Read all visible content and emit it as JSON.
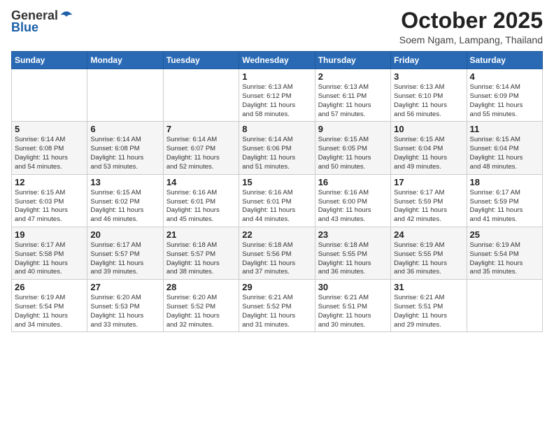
{
  "header": {
    "logo_general": "General",
    "logo_blue": "Blue",
    "title": "October 2025",
    "subtitle": "Soem Ngam, Lampang, Thailand"
  },
  "weekdays": [
    "Sunday",
    "Monday",
    "Tuesday",
    "Wednesday",
    "Thursday",
    "Friday",
    "Saturday"
  ],
  "weeks": [
    [
      {
        "day": "",
        "info": ""
      },
      {
        "day": "",
        "info": ""
      },
      {
        "day": "",
        "info": ""
      },
      {
        "day": "1",
        "info": "Sunrise: 6:13 AM\nSunset: 6:12 PM\nDaylight: 11 hours\nand 58 minutes."
      },
      {
        "day": "2",
        "info": "Sunrise: 6:13 AM\nSunset: 6:11 PM\nDaylight: 11 hours\nand 57 minutes."
      },
      {
        "day": "3",
        "info": "Sunrise: 6:13 AM\nSunset: 6:10 PM\nDaylight: 11 hours\nand 56 minutes."
      },
      {
        "day": "4",
        "info": "Sunrise: 6:14 AM\nSunset: 6:09 PM\nDaylight: 11 hours\nand 55 minutes."
      }
    ],
    [
      {
        "day": "5",
        "info": "Sunrise: 6:14 AM\nSunset: 6:08 PM\nDaylight: 11 hours\nand 54 minutes."
      },
      {
        "day": "6",
        "info": "Sunrise: 6:14 AM\nSunset: 6:08 PM\nDaylight: 11 hours\nand 53 minutes."
      },
      {
        "day": "7",
        "info": "Sunrise: 6:14 AM\nSunset: 6:07 PM\nDaylight: 11 hours\nand 52 minutes."
      },
      {
        "day": "8",
        "info": "Sunrise: 6:14 AM\nSunset: 6:06 PM\nDaylight: 11 hours\nand 51 minutes."
      },
      {
        "day": "9",
        "info": "Sunrise: 6:15 AM\nSunset: 6:05 PM\nDaylight: 11 hours\nand 50 minutes."
      },
      {
        "day": "10",
        "info": "Sunrise: 6:15 AM\nSunset: 6:04 PM\nDaylight: 11 hours\nand 49 minutes."
      },
      {
        "day": "11",
        "info": "Sunrise: 6:15 AM\nSunset: 6:04 PM\nDaylight: 11 hours\nand 48 minutes."
      }
    ],
    [
      {
        "day": "12",
        "info": "Sunrise: 6:15 AM\nSunset: 6:03 PM\nDaylight: 11 hours\nand 47 minutes."
      },
      {
        "day": "13",
        "info": "Sunrise: 6:15 AM\nSunset: 6:02 PM\nDaylight: 11 hours\nand 46 minutes."
      },
      {
        "day": "14",
        "info": "Sunrise: 6:16 AM\nSunset: 6:01 PM\nDaylight: 11 hours\nand 45 minutes."
      },
      {
        "day": "15",
        "info": "Sunrise: 6:16 AM\nSunset: 6:01 PM\nDaylight: 11 hours\nand 44 minutes."
      },
      {
        "day": "16",
        "info": "Sunrise: 6:16 AM\nSunset: 6:00 PM\nDaylight: 11 hours\nand 43 minutes."
      },
      {
        "day": "17",
        "info": "Sunrise: 6:17 AM\nSunset: 5:59 PM\nDaylight: 11 hours\nand 42 minutes."
      },
      {
        "day": "18",
        "info": "Sunrise: 6:17 AM\nSunset: 5:59 PM\nDaylight: 11 hours\nand 41 minutes."
      }
    ],
    [
      {
        "day": "19",
        "info": "Sunrise: 6:17 AM\nSunset: 5:58 PM\nDaylight: 11 hours\nand 40 minutes."
      },
      {
        "day": "20",
        "info": "Sunrise: 6:17 AM\nSunset: 5:57 PM\nDaylight: 11 hours\nand 39 minutes."
      },
      {
        "day": "21",
        "info": "Sunrise: 6:18 AM\nSunset: 5:57 PM\nDaylight: 11 hours\nand 38 minutes."
      },
      {
        "day": "22",
        "info": "Sunrise: 6:18 AM\nSunset: 5:56 PM\nDaylight: 11 hours\nand 37 minutes."
      },
      {
        "day": "23",
        "info": "Sunrise: 6:18 AM\nSunset: 5:55 PM\nDaylight: 11 hours\nand 36 minutes."
      },
      {
        "day": "24",
        "info": "Sunrise: 6:19 AM\nSunset: 5:55 PM\nDaylight: 11 hours\nand 36 minutes."
      },
      {
        "day": "25",
        "info": "Sunrise: 6:19 AM\nSunset: 5:54 PM\nDaylight: 11 hours\nand 35 minutes."
      }
    ],
    [
      {
        "day": "26",
        "info": "Sunrise: 6:19 AM\nSunset: 5:54 PM\nDaylight: 11 hours\nand 34 minutes."
      },
      {
        "day": "27",
        "info": "Sunrise: 6:20 AM\nSunset: 5:53 PM\nDaylight: 11 hours\nand 33 minutes."
      },
      {
        "day": "28",
        "info": "Sunrise: 6:20 AM\nSunset: 5:52 PM\nDaylight: 11 hours\nand 32 minutes."
      },
      {
        "day": "29",
        "info": "Sunrise: 6:21 AM\nSunset: 5:52 PM\nDaylight: 11 hours\nand 31 minutes."
      },
      {
        "day": "30",
        "info": "Sunrise: 6:21 AM\nSunset: 5:51 PM\nDaylight: 11 hours\nand 30 minutes."
      },
      {
        "day": "31",
        "info": "Sunrise: 6:21 AM\nSunset: 5:51 PM\nDaylight: 11 hours\nand 29 minutes."
      },
      {
        "day": "",
        "info": ""
      }
    ]
  ]
}
